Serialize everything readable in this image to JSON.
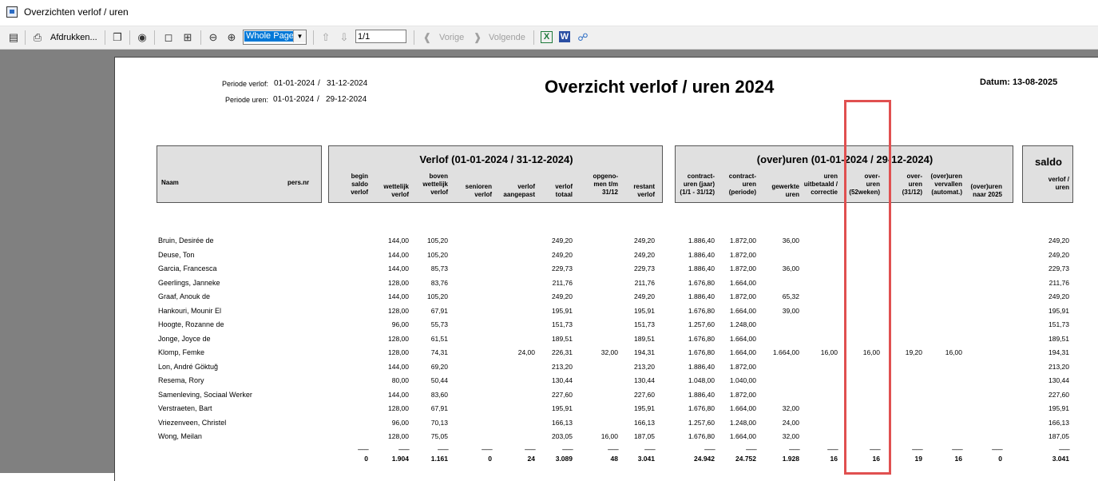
{
  "window": {
    "title": "Overzichten verlof / uren"
  },
  "toolbar": {
    "print_label": "Afdrukken...",
    "zoom_value": "Whole Page",
    "page_value": "1/1",
    "prev_label": "Vorige",
    "next_label": "Volgende"
  },
  "report": {
    "period_verlof_label": "Periode verlof:",
    "period_verlof_start": "01-01-2024",
    "period_verlof_end": "31-12-2024",
    "period_uren_label": "Periode uren:",
    "period_uren_start": "01-01-2024",
    "period_uren_end": "29-12-2024",
    "sep": "/",
    "title": "Overzicht verlof / uren 2024",
    "date_label": "Datum: 13-08-2025",
    "group1": {
      "naam": "Naam",
      "persnr": "pers.nr"
    },
    "group2": {
      "title": "Verlof (01-01-2024   /   31-12-2024)"
    },
    "group3": {
      "title": "(over)uren (01-01-2024   /   29-12-2024)"
    },
    "group4": {
      "title": "saldo"
    },
    "columns": [
      [
        "begin",
        "saldo",
        "verlof"
      ],
      [
        "wettelijk",
        "verlof"
      ],
      [
        "boven",
        "wettelijk",
        "verlof"
      ],
      [
        "senioren",
        "verlof"
      ],
      [
        "verlof",
        "aangepast"
      ],
      [
        "verlof",
        "totaal"
      ],
      [
        "opgeno-",
        "men t/m",
        "31/12"
      ],
      [
        "restant",
        "verlof"
      ],
      [
        "contract-",
        "uren (jaar)",
        "(1/1 - 31/12)"
      ],
      [
        "contract-",
        "uren",
        "(periode)"
      ],
      [
        "gewerkte",
        "uren"
      ],
      [
        "uren",
        "uitbetaald /",
        "correctie"
      ],
      [
        "over-",
        "uren",
        "(52weken)"
      ],
      [
        "over-",
        "uren",
        "(31/12)"
      ],
      [
        "(over)uren",
        "vervallen",
        "(automat.)"
      ],
      [
        "(over)uren",
        "naar 2025"
      ],
      [
        "verlof  /",
        "uren"
      ]
    ],
    "rows": [
      [
        "Bruin, Desirée de",
        "",
        "144,00",
        "105,20",
        "",
        "",
        "249,20",
        "",
        "249,20",
        "1.886,40",
        "1.872,00",
        "36,00",
        "",
        "",
        "",
        "",
        "",
        "249,20"
      ],
      [
        "Deuse, Ton",
        "",
        "144,00",
        "105,20",
        "",
        "",
        "249,20",
        "",
        "249,20",
        "1.886,40",
        "1.872,00",
        "",
        "",
        "",
        "",
        "",
        "",
        "249,20"
      ],
      [
        "Garcia, Francesca",
        "",
        "144,00",
        "85,73",
        "",
        "",
        "229,73",
        "",
        "229,73",
        "1.886,40",
        "1.872,00",
        "36,00",
        "",
        "",
        "",
        "",
        "",
        "229,73"
      ],
      [
        "Geerlings, Janneke",
        "",
        "128,00",
        "83,76",
        "",
        "",
        "211,76",
        "",
        "211,76",
        "1.676,80",
        "1.664,00",
        "",
        "",
        "",
        "",
        "",
        "",
        "211,76"
      ],
      [
        "Graaf, Anouk de",
        "",
        "144,00",
        "105,20",
        "",
        "",
        "249,20",
        "",
        "249,20",
        "1.886,40",
        "1.872,00",
        "65,32",
        "",
        "",
        "",
        "",
        "",
        "249,20"
      ],
      [
        "Hankouri, Mounir El",
        "",
        "128,00",
        "67,91",
        "",
        "",
        "195,91",
        "",
        "195,91",
        "1.676,80",
        "1.664,00",
        "39,00",
        "",
        "",
        "",
        "",
        "",
        "195,91"
      ],
      [
        "Hoogte, Rozanne de",
        "",
        "96,00",
        "55,73",
        "",
        "",
        "151,73",
        "",
        "151,73",
        "1.257,60",
        "1.248,00",
        "",
        "",
        "",
        "",
        "",
        "",
        "151,73"
      ],
      [
        "Jonge, Joyce de",
        "",
        "128,00",
        "61,51",
        "",
        "",
        "189,51",
        "",
        "189,51",
        "1.676,80",
        "1.664,00",
        "",
        "",
        "",
        "",
        "",
        "",
        "189,51"
      ],
      [
        "Klomp, Femke",
        "",
        "128,00",
        "74,31",
        "",
        "24,00",
        "226,31",
        "32,00",
        "194,31",
        "1.676,80",
        "1.664,00",
        "1.664,00",
        "16,00",
        "16,00",
        "19,20",
        "16,00",
        "",
        "194,31"
      ],
      [
        "Lon, André Göktuğ",
        "",
        "144,00",
        "69,20",
        "",
        "",
        "213,20",
        "",
        "213,20",
        "1.886,40",
        "1.872,00",
        "",
        "",
        "",
        "",
        "",
        "",
        "213,20"
      ],
      [
        "Resema, Rory",
        "",
        "80,00",
        "50,44",
        "",
        "",
        "130,44",
        "",
        "130,44",
        "1.048,00",
        "1.040,00",
        "",
        "",
        "",
        "",
        "",
        "",
        "130,44"
      ],
      [
        "Samenleving, Sociaal Werker",
        "",
        "144,00",
        "83,60",
        "",
        "",
        "227,60",
        "",
        "227,60",
        "1.886,40",
        "1.872,00",
        "",
        "",
        "",
        "",
        "",
        "",
        "227,60"
      ],
      [
        "Verstraeten, Bart",
        "",
        "128,00",
        "67,91",
        "",
        "",
        "195,91",
        "",
        "195,91",
        "1.676,80",
        "1.664,00",
        "32,00",
        "",
        "",
        "",
        "",
        "",
        "195,91"
      ],
      [
        "Vriezenveen, Christel",
        "",
        "96,00",
        "70,13",
        "",
        "",
        "166,13",
        "",
        "166,13",
        "1.257,60",
        "1.248,00",
        "24,00",
        "",
        "",
        "",
        "",
        "",
        "166,13"
      ],
      [
        "Wong, Meilan",
        "",
        "128,00",
        "75,05",
        "",
        "",
        "203,05",
        "16,00",
        "187,05",
        "1.676,80",
        "1.664,00",
        "32,00",
        "",
        "",
        "",
        "",
        "",
        "187,05"
      ]
    ],
    "dash": "--------",
    "totals": [
      "0",
      "1.904",
      "1.161",
      "0",
      "24",
      "3.089",
      "48",
      "3.041",
      "24.942",
      "24.752",
      "1.928",
      "16",
      "16",
      "19",
      "16",
      "0",
      "3.041"
    ]
  },
  "colors": {
    "highlight": "#e05050",
    "zoom_selection": "#0078d7"
  }
}
